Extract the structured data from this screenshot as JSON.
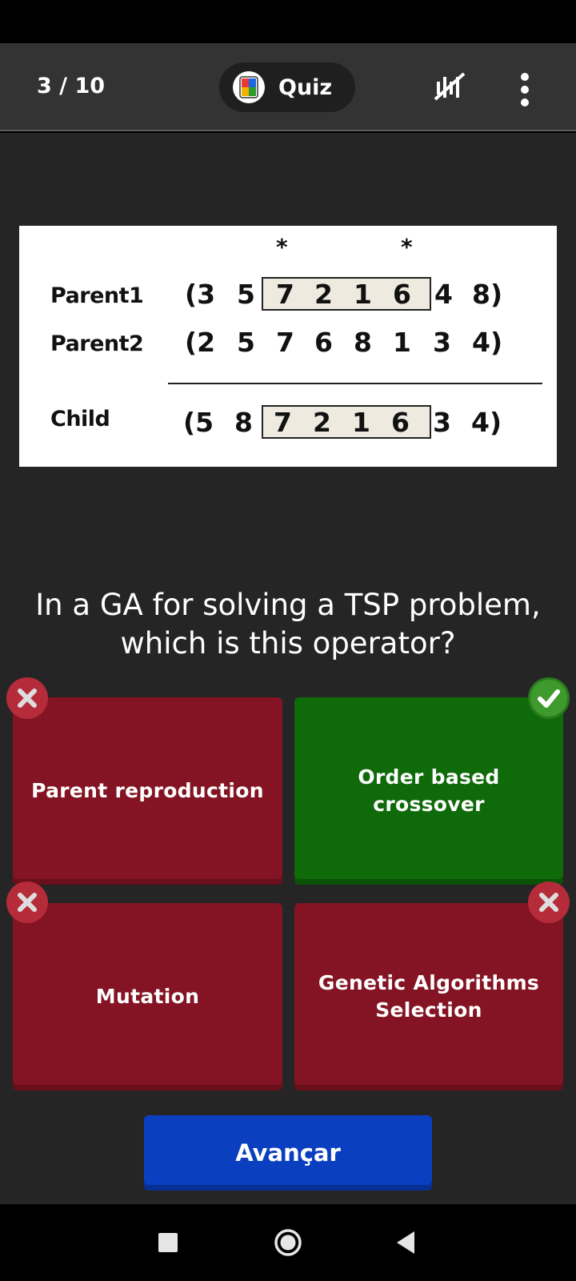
{
  "header": {
    "progress": "3 / 10",
    "app_title": "Quiz",
    "icons": [
      "quiz-logo-icon",
      "tools-off-icon",
      "more-vertical-icon"
    ]
  },
  "figure": {
    "markers": [
      "*",
      "*"
    ],
    "rows": [
      {
        "label": "Parent1",
        "sequence": [
          "(3",
          "5",
          "7",
          "2",
          "1",
          "6",
          "4",
          "8)"
        ]
      },
      {
        "label": "Parent2",
        "sequence": [
          "(2",
          "5",
          "7",
          "6",
          "8",
          "1",
          "3",
          "4)"
        ]
      },
      {
        "label": "Child",
        "sequence": [
          "(5",
          "8",
          "7",
          "2",
          "1",
          "6",
          "3",
          "4)"
        ]
      }
    ]
  },
  "question": "In a GA for solving a TSP problem, which is this operator?",
  "answers": [
    {
      "label": "Parent reproduction",
      "result": "incorrect",
      "color": "#841423"
    },
    {
      "label": "Order based crossover",
      "result": "correct",
      "color": "#0f6b0a"
    },
    {
      "label": "Mutation",
      "result": "incorrect",
      "color": "#841423"
    },
    {
      "label": "Genetic Algorithms Selection",
      "result": "incorrect",
      "color": "#841423"
    }
  ],
  "next_button": {
    "label": "Avançar",
    "color": "#0a3fbf"
  },
  "nav": {
    "icons": [
      "recent-apps-icon",
      "home-icon",
      "back-icon"
    ]
  }
}
